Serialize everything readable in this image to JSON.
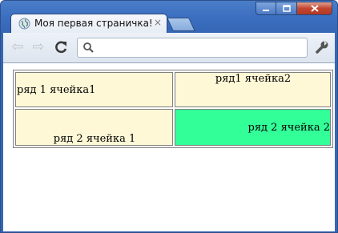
{
  "window": {
    "tab": {
      "title": "Моя первая страничка!",
      "close_glyph": "×"
    },
    "controls": {
      "accent": "#3566b5",
      "close_color": "#c4452f"
    }
  },
  "toolbar": {
    "back_glyph": "⇦",
    "forward_glyph": "⇨",
    "reload_glyph": "C",
    "address": {
      "value": "",
      "placeholder": ""
    }
  },
  "table": {
    "rows": [
      {
        "cells": [
          "ряд 1 ячейка1",
          "ряд1 ячейка2"
        ]
      },
      {
        "cells": [
          "ряд 2 ячейка 1",
          "ряд 2 ячейка 2"
        ]
      }
    ],
    "cell_bg": "#fff8d6",
    "highlight_bg": "#33ff99"
  }
}
